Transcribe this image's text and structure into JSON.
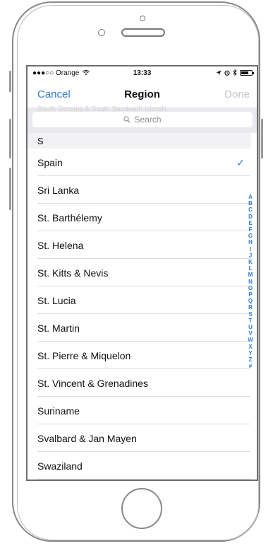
{
  "status_bar": {
    "carrier": "●●●○○ Orange",
    "time": "13:33",
    "battery_level": 0.7
  },
  "nav": {
    "cancel": "Cancel",
    "title": "Region",
    "done": "Done"
  },
  "search": {
    "ghost_text": "South Georgia & South Sandwich Islands",
    "placeholder": "Search"
  },
  "section": {
    "header": "S"
  },
  "rows": [
    {
      "label": "Spain",
      "selected": true
    },
    {
      "label": "Sri Lanka"
    },
    {
      "label": "St. Barthélemy"
    },
    {
      "label": "St. Helena"
    },
    {
      "label": "St. Kitts & Nevis"
    },
    {
      "label": "St. Lucia"
    },
    {
      "label": "St. Martin"
    },
    {
      "label": "St. Pierre & Miquelon"
    },
    {
      "label": "St. Vincent & Grenadines"
    },
    {
      "label": "Suriname"
    },
    {
      "label": "Svalbard & Jan Mayen"
    },
    {
      "label": "Swaziland"
    }
  ],
  "checkmark": "✓",
  "index_letters": [
    "A",
    "B",
    "C",
    "D",
    "E",
    "F",
    "G",
    "H",
    "I",
    "J",
    "K",
    "L",
    "M",
    "N",
    "O",
    "P",
    "Q",
    "R",
    "S",
    "T",
    "U",
    "V",
    "W",
    "X",
    "Y",
    "Z",
    "#"
  ],
  "colors": {
    "accent": "#2f7bd6",
    "disabled": "#c4c4c4"
  }
}
